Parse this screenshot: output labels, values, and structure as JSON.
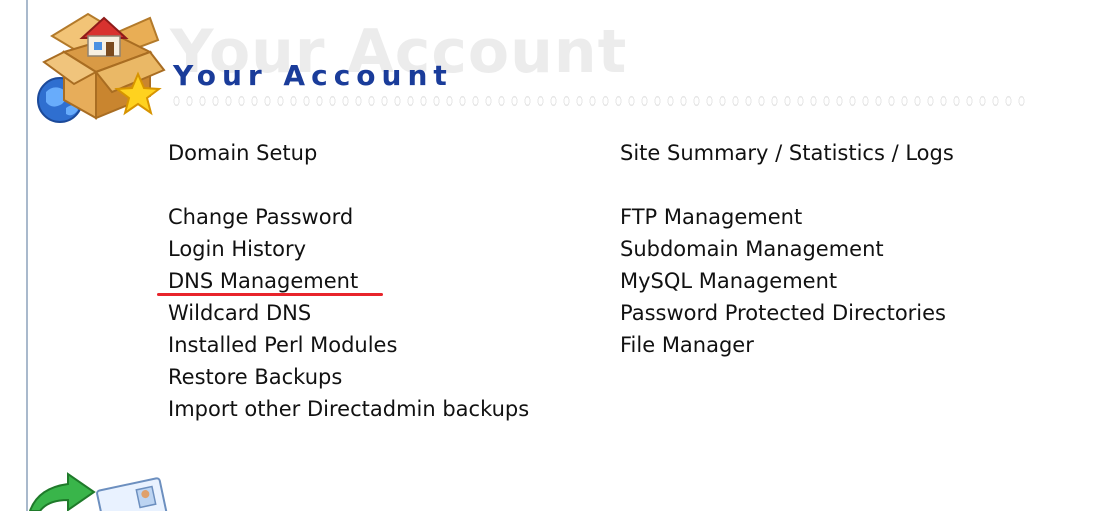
{
  "header": {
    "watermark_text": "Your Account",
    "title": "Your Account",
    "icon": "house-box-globe-star-icon"
  },
  "left_menu": {
    "items": [
      {
        "label": "Domain Setup"
      },
      {
        "label": "Change Password"
      },
      {
        "label": "Login History"
      },
      {
        "label": "DNS Management"
      },
      {
        "label": "Wildcard DNS"
      },
      {
        "label": "Installed Perl Modules"
      },
      {
        "label": "Restore Backups"
      },
      {
        "label": "Import other Directadmin backups"
      }
    ]
  },
  "right_menu": {
    "items": [
      {
        "label": "Site Summary / Statistics / Logs"
      },
      {
        "label": "FTP Management"
      },
      {
        "label": "Subdomain Management"
      },
      {
        "label": "MySQL Management"
      },
      {
        "label": "Password Protected Directories"
      },
      {
        "label": "File Manager"
      }
    ]
  },
  "annotation": {
    "highlighted_item": "DNS Management",
    "color": "#e8242b"
  },
  "next_section": {
    "icon": "arrow-id-card-icon"
  },
  "colors": {
    "title": "#1a3c9a",
    "watermark": "#ececec",
    "link": "#111111",
    "left_rule": "#a9b9cc"
  }
}
